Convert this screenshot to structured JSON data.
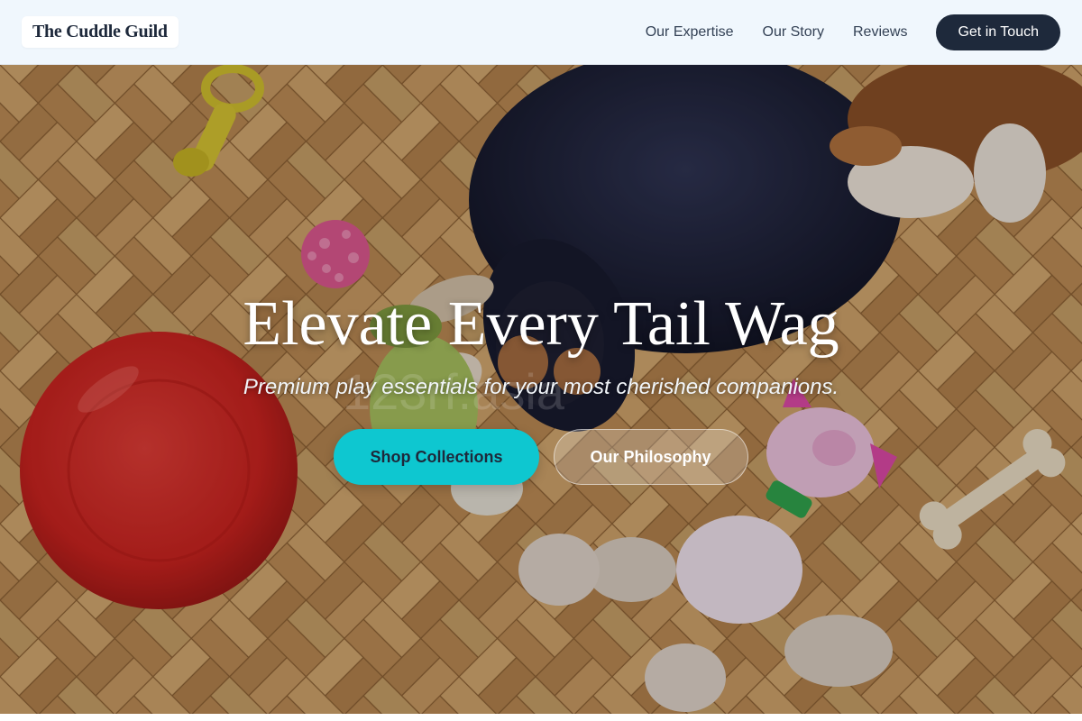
{
  "header": {
    "logo": "The Cuddle Guild",
    "nav": [
      "Our Expertise",
      "Our Story",
      "Reviews"
    ],
    "cta": "Get in Touch"
  },
  "hero": {
    "title": "Elevate Every Tail Wag",
    "subtitle": "Premium play essentials for your most cherished companions.",
    "primary_button": "Shop Collections",
    "secondary_button": "Our Philosophy",
    "watermark": "123rf.asia"
  },
  "colors": {
    "header_bg": "#f0f7fd",
    "cta_bg": "#1e293b",
    "primary_button_bg": "#0ec7d0",
    "floor_wood": "#c99a5a"
  }
}
